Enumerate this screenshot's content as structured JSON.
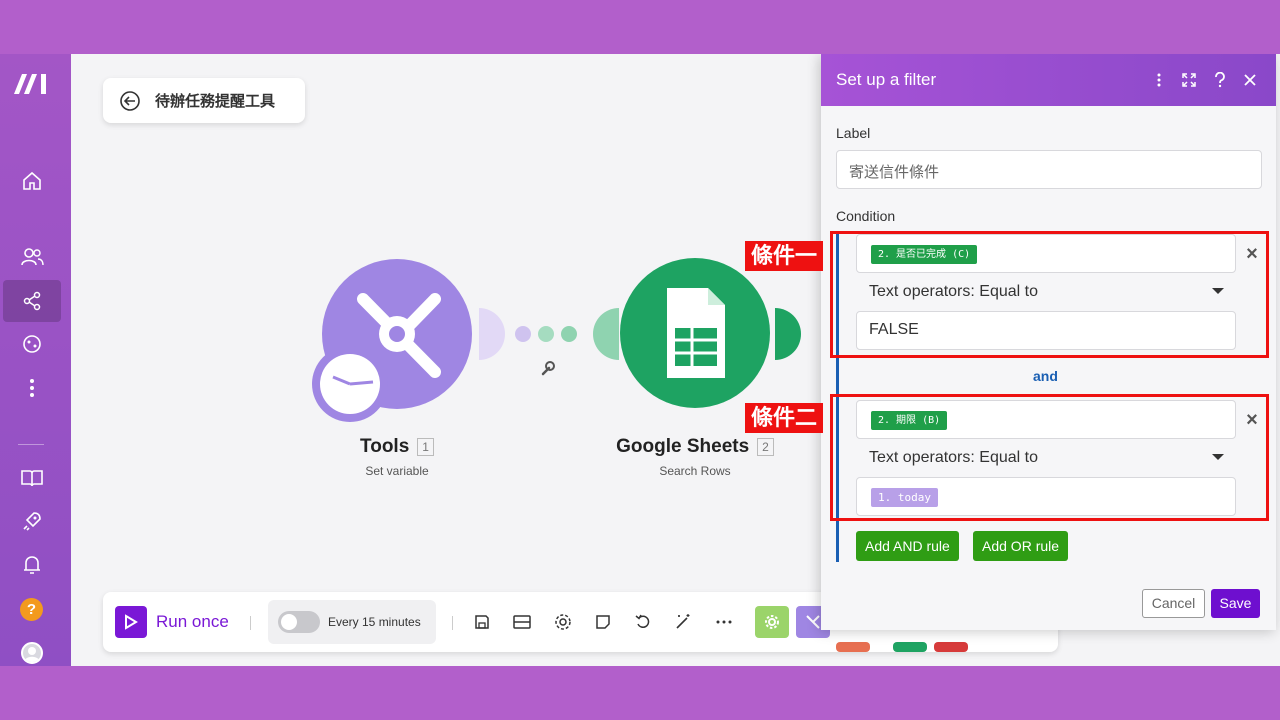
{
  "scenario": {
    "title": "待辦任務提醒工具"
  },
  "modules": [
    {
      "name": "Tools",
      "number": "1",
      "subtitle": "Set variable"
    },
    {
      "name": "Google Sheets",
      "number": "2",
      "subtitle": "Search Rows"
    }
  ],
  "toolbar": {
    "run_label": "Run once",
    "schedule_label": "Every 15 minutes"
  },
  "panel": {
    "title": "Set up a filter",
    "label_caption": "Label",
    "label_value": "寄送信件條件",
    "condition_caption": "Condition",
    "rules": [
      {
        "field": "2. 是否已完成 (C)",
        "operator": "Text operators: Equal to",
        "value": "FALSE"
      },
      {
        "field": "2. 期限 (B)",
        "operator": "Text operators: Equal to",
        "value": "1. today"
      }
    ],
    "joiner": "and",
    "add_and": "Add AND rule",
    "add_or": "Add OR rule",
    "cancel": "Cancel",
    "save": "Save"
  },
  "annotations": [
    "條件一",
    "條件二"
  ],
  "colors": {
    "brand_purple": "#7a18d6",
    "sheets_green": "#1ea362",
    "tools_purple": "#9f86e3",
    "annotation_red": "#ee1111",
    "rule_green": "#2f9d14"
  }
}
